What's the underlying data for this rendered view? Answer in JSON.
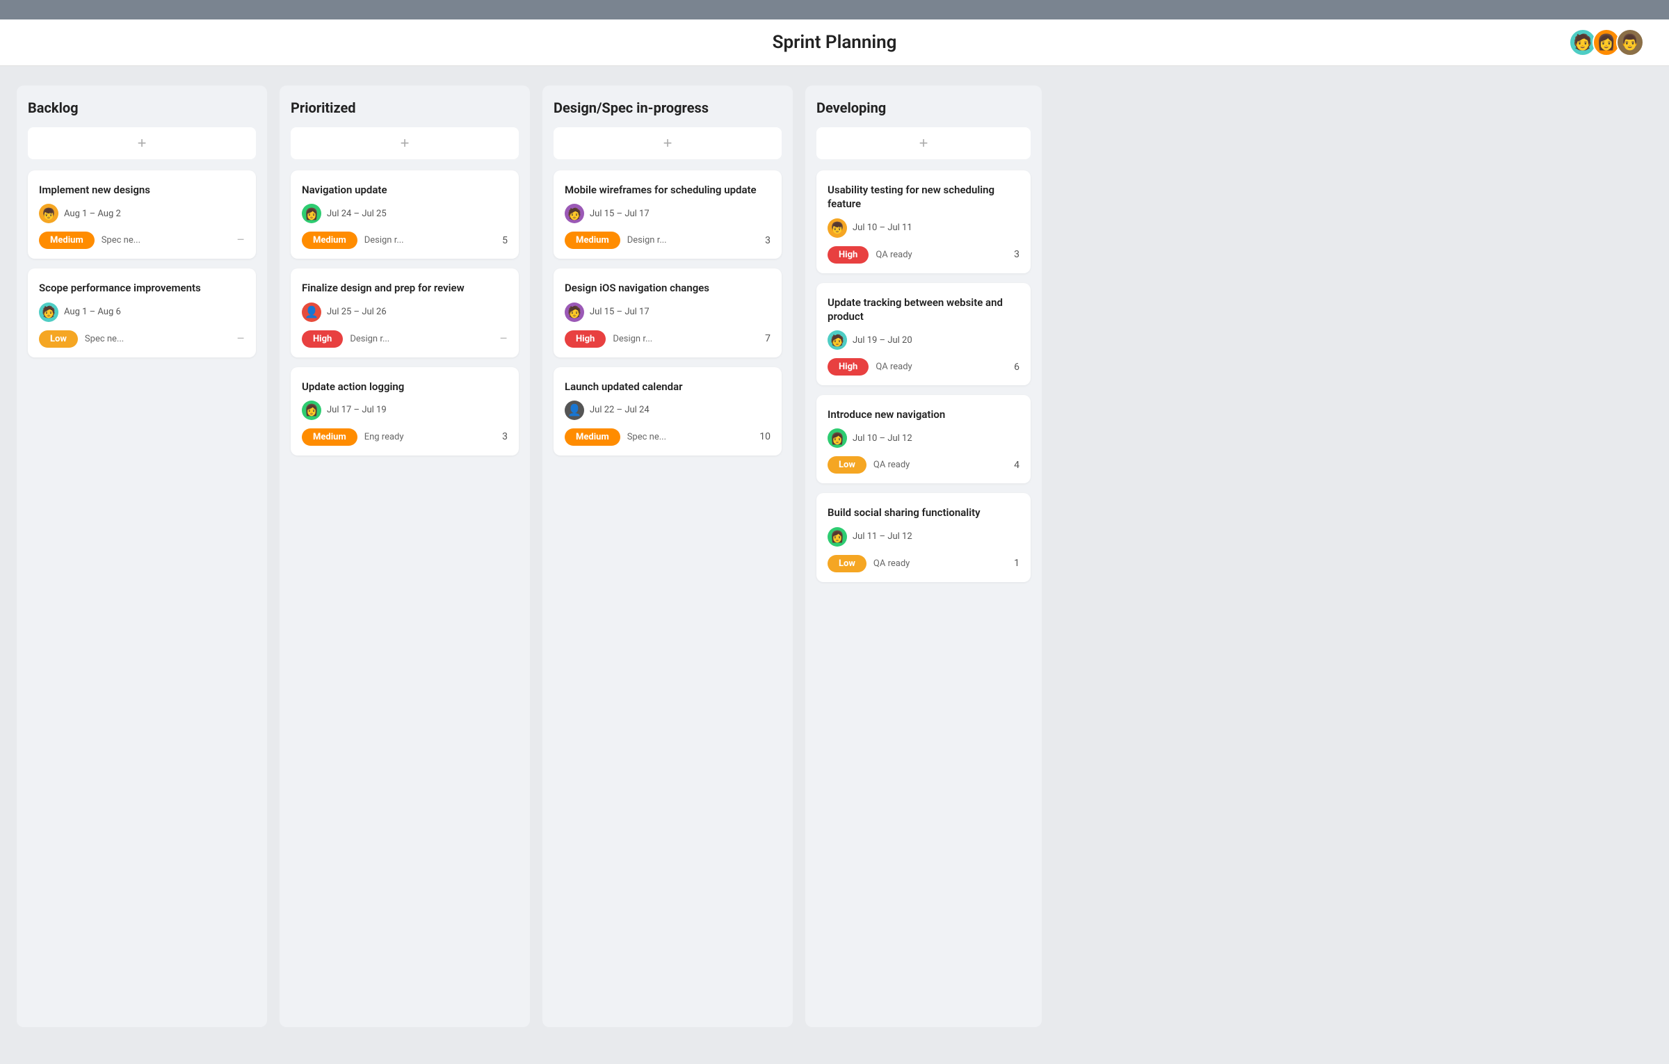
{
  "header": {
    "title": "Sprint Planning",
    "avatars": [
      {
        "id": "av1",
        "emoji": "🧑",
        "color": "#4ecdc4"
      },
      {
        "id": "av2",
        "emoji": "👩",
        "color": "#ff8c00"
      },
      {
        "id": "av3",
        "emoji": "👨",
        "color": "#8b6f47"
      }
    ]
  },
  "columns": [
    {
      "id": "backlog",
      "title": "Backlog",
      "cards": [
        {
          "id": "c1",
          "title": "Implement new designs",
          "date": "Aug 1 – Aug 2",
          "avatar_emoji": "👦",
          "avatar_color": "#f5a623",
          "badge": "Medium",
          "badge_class": "badge-medium",
          "status": "Spec ne...",
          "count": null,
          "show_minus": true
        },
        {
          "id": "c2",
          "title": "Scope performance improvements",
          "date": "Aug 1 – Aug 6",
          "avatar_emoji": "🧑",
          "avatar_color": "#4ecdc4",
          "badge": "Low",
          "badge_class": "badge-low",
          "status": "Spec ne...",
          "count": null,
          "show_minus": true
        }
      ]
    },
    {
      "id": "prioritized",
      "title": "Prioritized",
      "cards": [
        {
          "id": "c3",
          "title": "Navigation update",
          "date": "Jul 24 – Jul 25",
          "avatar_emoji": "👩",
          "avatar_color": "#2ecc71",
          "badge": "Medium",
          "badge_class": "badge-medium",
          "status": "Design r...",
          "count": "5",
          "show_minus": false
        },
        {
          "id": "c4",
          "title": "Finalize design and prep for review",
          "date": "Jul 25 – Jul 26",
          "avatar_emoji": "👤",
          "avatar_color": "#e74c3c",
          "badge": "High",
          "badge_class": "badge-high",
          "status": "Design r...",
          "count": null,
          "show_minus": true
        },
        {
          "id": "c5",
          "title": "Update action logging",
          "date": "Jul 17 – Jul 19",
          "avatar_emoji": "👩",
          "avatar_color": "#2ecc71",
          "badge": "Medium",
          "badge_class": "badge-medium",
          "status": "Eng ready",
          "count": "3",
          "show_minus": false
        }
      ]
    },
    {
      "id": "design-spec",
      "title": "Design/Spec in-progress",
      "cards": [
        {
          "id": "c6",
          "title": "Mobile wireframes for scheduling update",
          "date": "Jul 15 – Jul 17",
          "avatar_emoji": "🧑",
          "avatar_color": "#9b59b6",
          "badge": "Medium",
          "badge_class": "badge-medium",
          "status": "Design r...",
          "count": "3",
          "show_minus": false
        },
        {
          "id": "c7",
          "title": "Design iOS navigation changes",
          "date": "Jul 15 – Jul 17",
          "avatar_emoji": "🧑",
          "avatar_color": "#9b59b6",
          "badge": "High",
          "badge_class": "badge-high",
          "status": "Design r...",
          "count": "7",
          "show_minus": false
        },
        {
          "id": "c8",
          "title": "Launch updated calendar",
          "date": "Jul 22 – Jul 24",
          "avatar_emoji": "👤",
          "avatar_color": "#555",
          "badge": "Medium",
          "badge_class": "badge-medium",
          "status": "Spec ne...",
          "count": "10",
          "show_minus": false
        }
      ]
    },
    {
      "id": "developing",
      "title": "Developing",
      "cards": [
        {
          "id": "c9",
          "title": "Usability testing for new scheduling feature",
          "date": "Jul 10 – Jul 11",
          "avatar_emoji": "👦",
          "avatar_color": "#f5a623",
          "badge": "High",
          "badge_class": "badge-high",
          "status": "QA ready",
          "count": "3",
          "show_minus": false
        },
        {
          "id": "c10",
          "title": "Update tracking between website and product",
          "date": "Jul 19 – Jul 20",
          "avatar_emoji": "🧑",
          "avatar_color": "#4ecdc4",
          "badge": "High",
          "badge_class": "badge-high",
          "status": "QA ready",
          "count": "6",
          "show_minus": false
        },
        {
          "id": "c11",
          "title": "Introduce new navigation",
          "date": "Jul 10 – Jul 12",
          "avatar_emoji": "👩",
          "avatar_color": "#2ecc71",
          "badge": "Low",
          "badge_class": "badge-low",
          "status": "QA ready",
          "count": "4",
          "show_minus": false
        },
        {
          "id": "c12",
          "title": "Build social sharing functionality",
          "date": "Jul 11 – Jul 12",
          "avatar_emoji": "👩",
          "avatar_color": "#2ecc71",
          "badge": "Low",
          "badge_class": "badge-low",
          "status": "QA ready",
          "count": "1",
          "show_minus": false
        }
      ]
    }
  ],
  "add_button_label": "+",
  "avatar_colors": {
    "av1": "#4ecdc4",
    "av2": "#ff8c00",
    "av3": "#8b6f47"
  }
}
